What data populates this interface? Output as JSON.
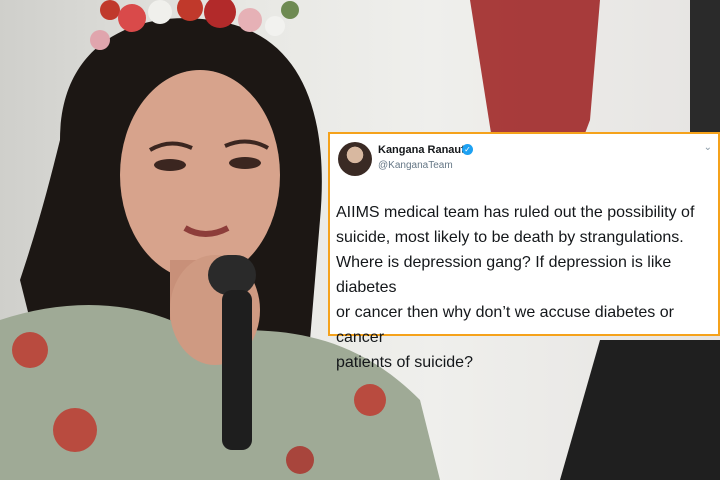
{
  "tweet": {
    "author_name": "Kangana Ranaut",
    "handle": "@KanganaTeam",
    "verified_icon": "verified-badge-icon",
    "text": "AIIMS medical team has ruled out the possibility of\nsuicide, most likely to be death by strangulations.\nWhere is depression gang? If depression is like diabetes\nor cancer then why don’t we accuse diabetes or cancer\npatients of suicide?"
  },
  "colors": {
    "card_border": "#f5a21b",
    "verified": "#1da1f2",
    "handle": "#657786"
  }
}
